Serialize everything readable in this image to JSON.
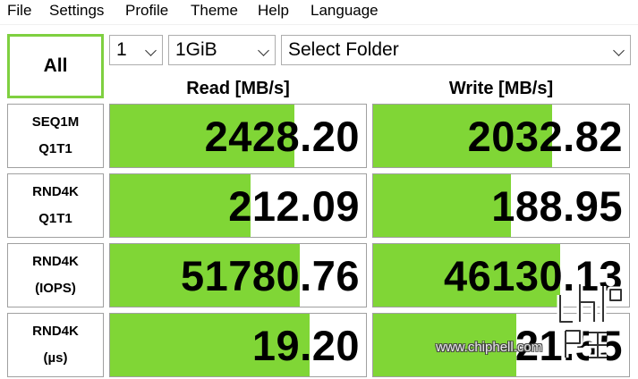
{
  "menu": [
    "File",
    "Settings",
    "Profile",
    "Theme",
    "Help",
    "Language"
  ],
  "all_button": "All",
  "selects": {
    "count": "1",
    "size": "1GiB",
    "folder": "Select Folder"
  },
  "headers": {
    "read": "Read [MB/s]",
    "write": "Write [MB/s]"
  },
  "rows": [
    {
      "label1": "SEQ1M",
      "label2": "Q1T1",
      "read": "2428.20",
      "write": "2032.82",
      "read_fill": 0.72,
      "write_fill": 0.7
    },
    {
      "label1": "RND4K",
      "label2": "Q1T1",
      "read": "212.09",
      "write": "188.95",
      "read_fill": 0.55,
      "write_fill": 0.54
    },
    {
      "label1": "RND4K",
      "label2": "(IOPS)",
      "read": "51780.76",
      "write": "46130.13",
      "read_fill": 0.74,
      "write_fill": 0.73
    },
    {
      "label1": "RND4K",
      "label2": "(µs)",
      "read": "19.20",
      "write": "21.55",
      "read_fill": 0.78,
      "write_fill": 0.56
    }
  ],
  "colors": {
    "bar": "#80d636",
    "all_border": "#7fd040"
  },
  "watermark": "www.chiphell.com"
}
